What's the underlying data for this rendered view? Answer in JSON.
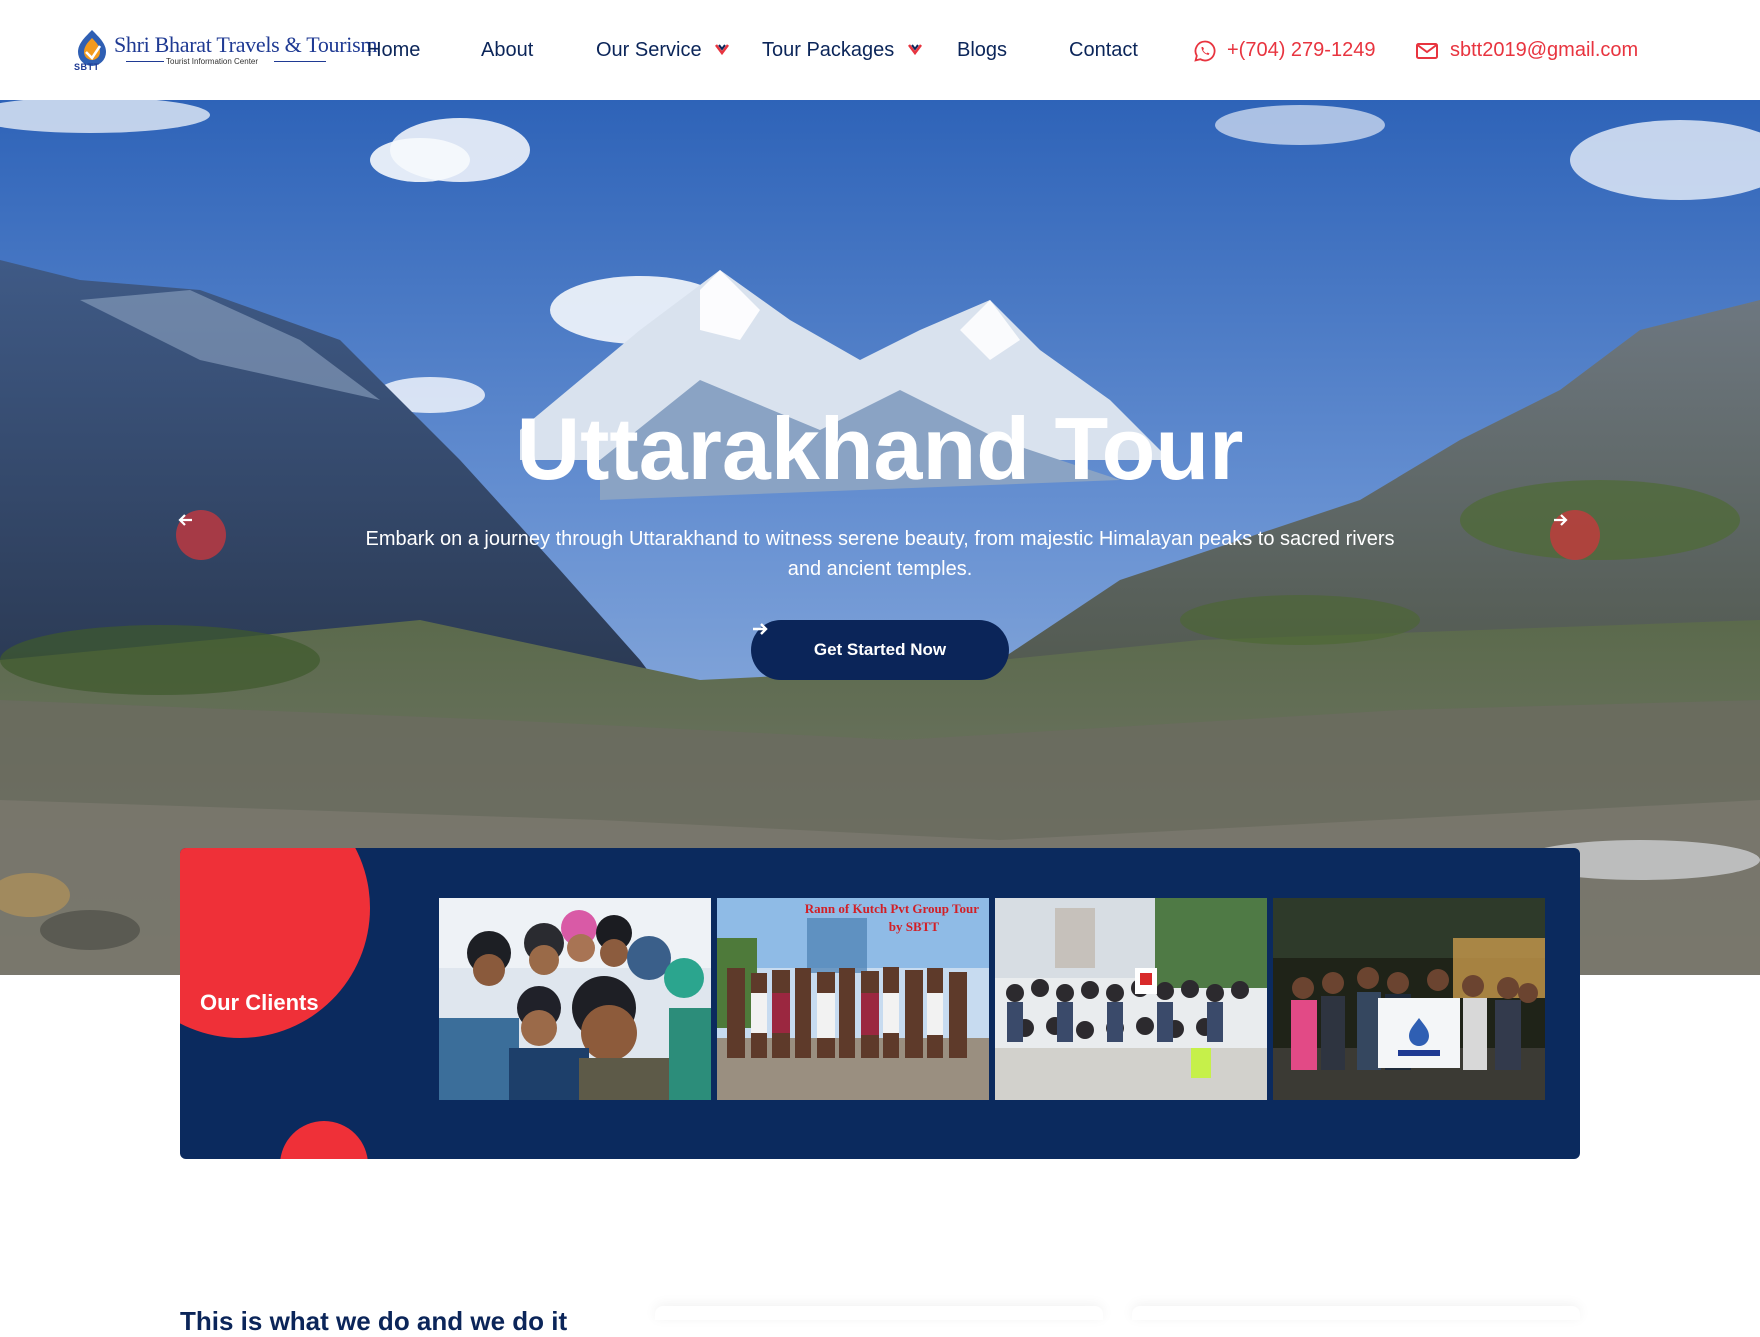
{
  "brand": {
    "name": "Shri Bharat Travels & Tourism",
    "tagline": "Tourist Information Center",
    "abbr": "SBTT"
  },
  "nav": {
    "items": [
      {
        "label": "Home"
      },
      {
        "label": "About"
      },
      {
        "label": "Our Service"
      },
      {
        "label": "Tour Packages"
      },
      {
        "label": "Blogs"
      },
      {
        "label": "Contact"
      }
    ]
  },
  "contact": {
    "phone": "+(704) 279-1249",
    "email": "sbtt2019@gmail.com"
  },
  "hero": {
    "title": "Uttarakhand Tour",
    "subtitle": "Embark on a journey through Uttarakhand to witness serene beauty, from majestic Himalayan peaks to sacred rivers and ancient temples.",
    "cta_label": "Get Started Now"
  },
  "clients": {
    "label": "Our Clients",
    "photo_caption_line1": "Rann of Kutch Pvt Group Tour",
    "photo_caption_line2": "by SBTT"
  },
  "section": {
    "heading": "This is what we do and we do it"
  },
  "colors": {
    "navy": "#0b2559",
    "red": "#e8343f",
    "white": "#ffffff"
  }
}
